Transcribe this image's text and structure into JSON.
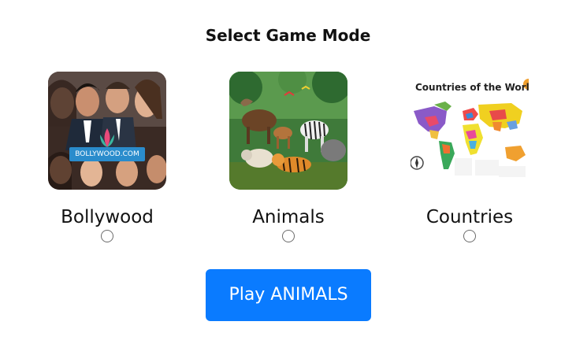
{
  "title": "Select Game Mode",
  "modes": [
    {
      "label": "Bollywood",
      "image": "bollywood-actors-collage",
      "logo_text": "BOLLYWOOD.COM",
      "selected": false
    },
    {
      "label": "Animals",
      "image": "animals-forest-illustration",
      "selected": false
    },
    {
      "label": "Countries",
      "image": "world-map",
      "map_title": "Countries of the World",
      "selected": false
    }
  ],
  "play_button": {
    "label": "Play ANIMALS",
    "color": "#0a7bff"
  }
}
